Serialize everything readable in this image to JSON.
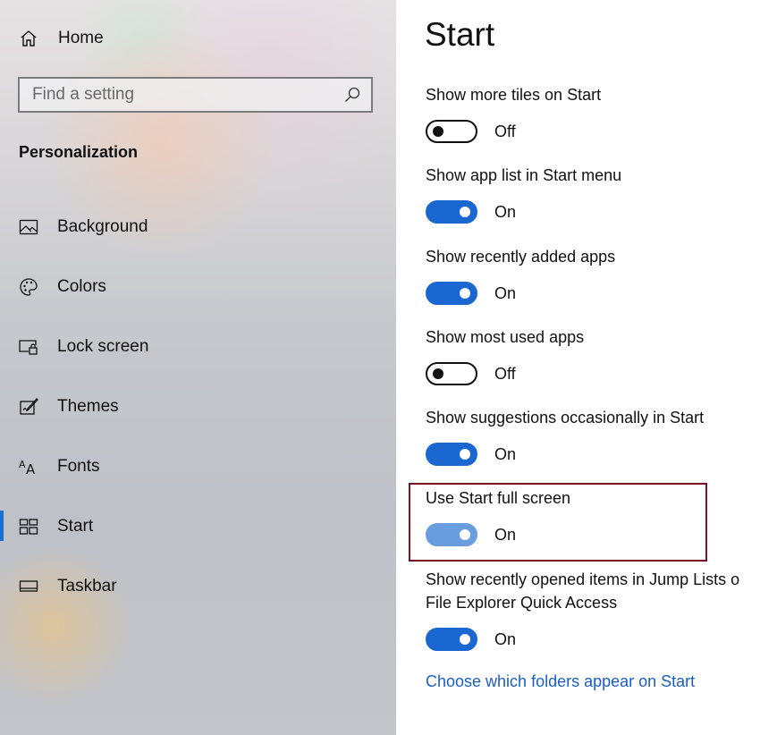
{
  "nav": {
    "home_label": "Home",
    "search": {
      "placeholder": "Find a setting"
    },
    "section_title": "Personalization",
    "items": [
      {
        "label": "Background",
        "icon": "picture-icon"
      },
      {
        "label": "Colors",
        "icon": "palette-icon"
      },
      {
        "label": "Lock screen",
        "icon": "lock-screen-icon"
      },
      {
        "label": "Themes",
        "icon": "brush-icon"
      },
      {
        "label": "Fonts",
        "icon": "fonts-icon"
      },
      {
        "label": "Start",
        "icon": "start-tiles-icon",
        "selected": true
      },
      {
        "label": "Taskbar",
        "icon": "taskbar-icon"
      }
    ]
  },
  "content": {
    "title": "Start",
    "settings": [
      {
        "label": "Show more tiles on Start",
        "state": "Off"
      },
      {
        "label": "Show app list in Start menu",
        "state": "On"
      },
      {
        "label": "Show recently added apps",
        "state": "On"
      },
      {
        "label": "Show most used apps",
        "state": "Off"
      },
      {
        "label": "Show suggestions occasionally in Start",
        "state": "On"
      },
      {
        "label": "Use Start full screen",
        "state": "On",
        "highlighted": true
      },
      {
        "label": "Show recently opened items in Jump Lists o",
        "label2": "File Explorer Quick Access",
        "state": "On"
      }
    ],
    "link": "Choose which folders appear on Start"
  },
  "colors": {
    "accent": "#1a67d1",
    "link": "#1a5fbf",
    "highlight_border": "#7b1320"
  }
}
